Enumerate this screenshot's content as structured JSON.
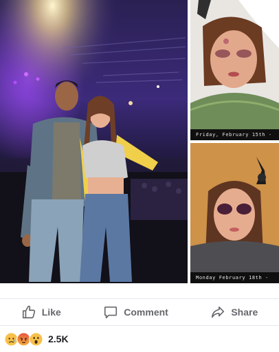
{
  "post": {
    "photos": [
      {
        "caption": ""
      },
      {
        "caption": "Friday, February 15th -"
      },
      {
        "caption": "Monday February 18th -"
      }
    ]
  },
  "actions": {
    "like": "Like",
    "comment": "Comment",
    "share": "Share"
  },
  "reactions": {
    "icons": [
      "sad-reaction",
      "angry-reaction",
      "wow-reaction"
    ],
    "count": "2.5K"
  },
  "colors": {
    "action_text": "#65676b",
    "divider": "#e4e6eb",
    "count_text": "#1c1e21"
  }
}
